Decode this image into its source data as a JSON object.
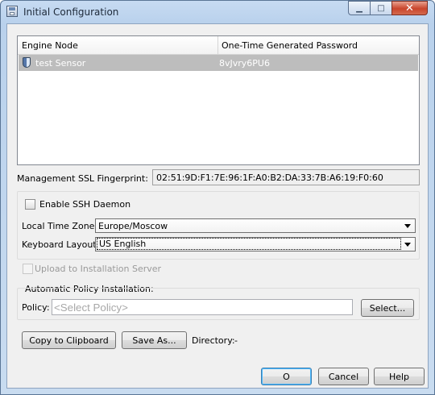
{
  "window": {
    "title": "Initial Configuration",
    "controls": {
      "minimize": "▁",
      "maximize": "□",
      "close": "✕"
    }
  },
  "table": {
    "columns": [
      "Engine Node",
      "One-Time Generated Password"
    ],
    "rows": [
      {
        "node": "test Sensor",
        "password": "8vJvry6PU6",
        "selected": true
      }
    ]
  },
  "fingerprint": {
    "label": "Management SSL Fingerprint:",
    "value": "02:51:9D:F1:7E:96:1F:A0:B2:DA:33:7B:A6:19:F0:60"
  },
  "ssh": {
    "label": "Enable SSH Daemon",
    "checked": false
  },
  "timezone": {
    "label": "Local Time Zone:",
    "value": "Europe/Moscow"
  },
  "keyboard": {
    "label": "Keyboard Layout:",
    "value": "US English"
  },
  "upload": {
    "label": "Upload to Installation Server",
    "checked": false,
    "enabled": false
  },
  "policy": {
    "group_label": "Automatic Policy Installation:",
    "label": "Policy:",
    "placeholder": "<Select Policy>",
    "select_button": "Select..."
  },
  "actions": {
    "copy": "Copy to Clipboard",
    "save_as": "Save As...",
    "directory_label": "Directory:",
    "directory_value": "-"
  },
  "footer": {
    "ok": "O",
    "cancel": "Cancel",
    "help": "Help"
  }
}
